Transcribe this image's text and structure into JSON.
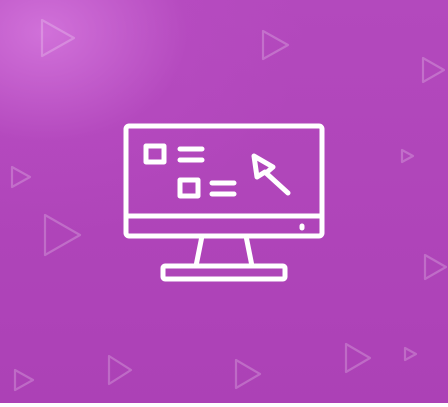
{
  "colors": {
    "background": "#ae43b8",
    "background_glow": "#d678de",
    "icon_stroke": "#ffffff",
    "decoration": "rgba(255,255,255,0.22)"
  },
  "icons": {
    "main": "computer-monitor-icon",
    "screen_items": [
      "checkbox-icon",
      "list-line-icon",
      "cursor-arrow-icon"
    ],
    "background_pattern": "play-triangle-icon"
  }
}
